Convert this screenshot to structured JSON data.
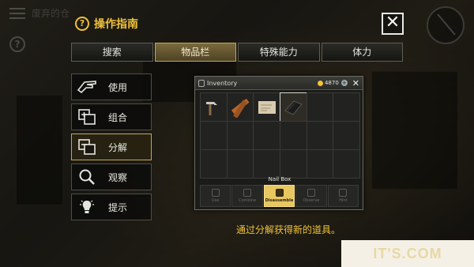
{
  "hud": {
    "title": "废弃的仓"
  },
  "guide": {
    "title": "操作指南",
    "close_label": "✕",
    "tabs": [
      {
        "label": "搜索",
        "active": false
      },
      {
        "label": "物品栏",
        "active": true
      },
      {
        "label": "特殊能力",
        "active": false
      },
      {
        "label": "体力",
        "active": false
      }
    ],
    "actions": [
      {
        "label": "使用",
        "icon": "hand-use-icon",
        "active": false
      },
      {
        "label": "组合",
        "icon": "combine-icon",
        "active": false
      },
      {
        "label": "分解",
        "icon": "disassemble-icon",
        "active": true
      },
      {
        "label": "观察",
        "icon": "magnifier-icon",
        "active": false
      },
      {
        "label": "提示",
        "icon": "lightbulb-icon",
        "active": false
      }
    ],
    "hint": "通过分解获得新的道具。"
  },
  "inventory": {
    "title": "Inventory",
    "money": "4870",
    "items": [
      {
        "icon": "hammer-icon"
      },
      {
        "icon": "wood-planks-icon"
      },
      {
        "icon": "paper-note-icon"
      },
      {
        "icon": "nail-box-icon",
        "selected": true
      }
    ],
    "selected_item_name": "Nail Box",
    "action_buttons": [
      {
        "label": "Use",
        "active": false
      },
      {
        "label": "Combine",
        "active": false
      },
      {
        "label": "Disassemble",
        "active": true
      },
      {
        "label": "Observe",
        "active": false
      },
      {
        "label": "Hint",
        "active": false
      }
    ]
  },
  "colors": {
    "accent": "#f0c23a",
    "tab_active": "#7a6a3c",
    "inv_action_active": "#e8c660"
  },
  "watermark": "IT'S.COM"
}
